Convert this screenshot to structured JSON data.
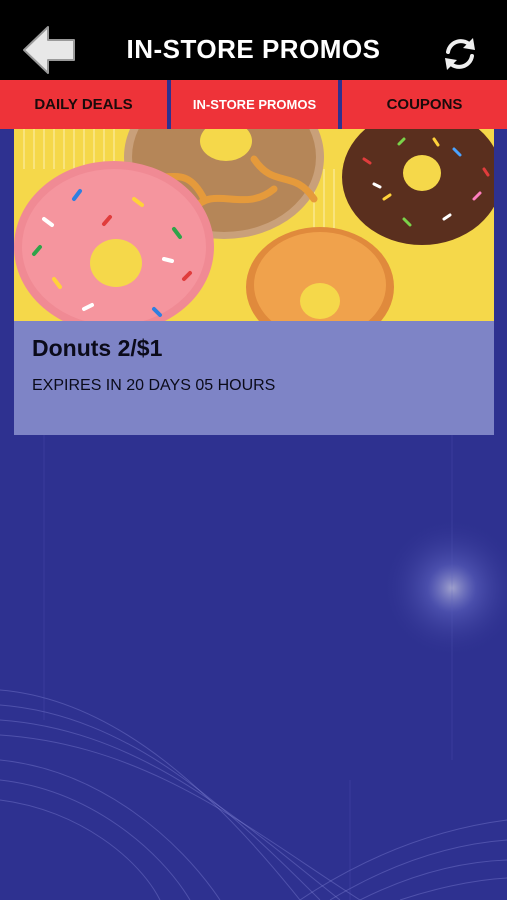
{
  "header": {
    "title": "IN-STORE PROMOS",
    "back_icon": "back-arrow-icon",
    "refresh_icon": "refresh-icon"
  },
  "tabs": [
    {
      "label": "DAILY DEALS",
      "active": false
    },
    {
      "label": "IN-STORE PROMOS",
      "active": true
    },
    {
      "label": "COUPONS",
      "active": false
    }
  ],
  "promos": [
    {
      "title": "Donuts 2/$1",
      "expiry": "EXPIRES IN 20 DAYS 05 HOURS",
      "image": "donuts-photo"
    }
  ],
  "colors": {
    "background": "#2e3190",
    "tab": "#ee3339",
    "card_body": "#7e84c6",
    "topbar": "#000000"
  }
}
